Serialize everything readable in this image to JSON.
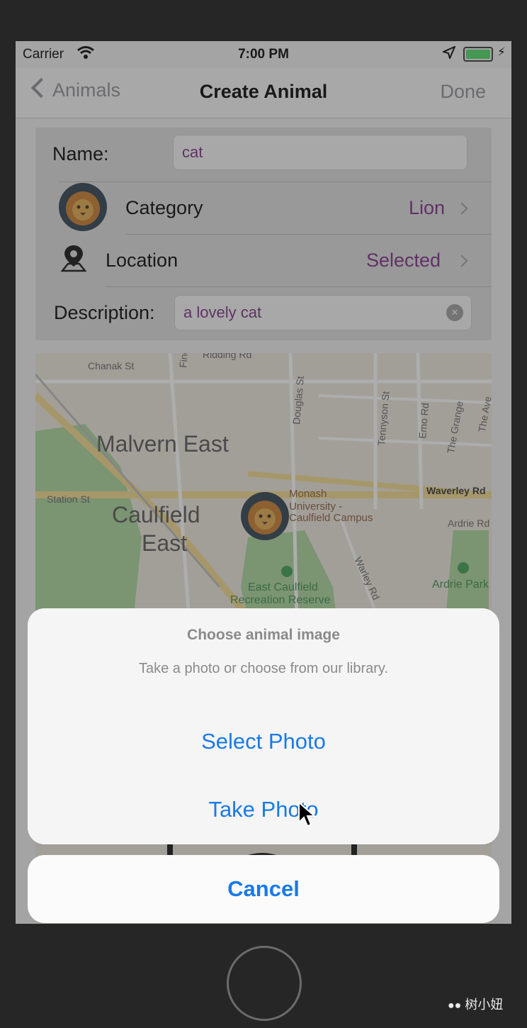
{
  "status_bar": {
    "carrier": "Carrier",
    "time": "7:00 PM"
  },
  "nav": {
    "back_label": "Animals",
    "title": "Create Animal",
    "done_label": "Done"
  },
  "form": {
    "name_label": "Name:",
    "name_value": "cat",
    "category_label": "Category",
    "category_value": "Lion",
    "location_label": "Location",
    "location_value": "Selected",
    "description_label": "Description:",
    "description_value": "a lovely cat"
  },
  "map": {
    "areas": [
      "Malvern East",
      "Caulfield",
      "East"
    ],
    "streets": [
      "Chanak St",
      "Finch St",
      "Douglas St",
      "Tennyson St",
      "Emo Rd",
      "The Grange",
      "The Ave",
      "Station St",
      "Waverley Rd",
      "Ardrie Rd",
      "Warley Rd",
      "Ridding Rd"
    ],
    "places": [
      "East Caulfield",
      "Recreation Reserve",
      "Ardrie Park",
      "Monash",
      "University -",
      "Caulfield Campus"
    ]
  },
  "action_sheet": {
    "title": "Choose animal image",
    "message": "Take a photo or choose from our library.",
    "select_photo": "Select Photo",
    "take_photo": "Take Photo",
    "cancel": "Cancel"
  },
  "watermark": "树小妞",
  "colors": {
    "accent_blue": "#1a7ae6",
    "value_purple": "#7a2a86",
    "battery_green": "#4cd964"
  }
}
